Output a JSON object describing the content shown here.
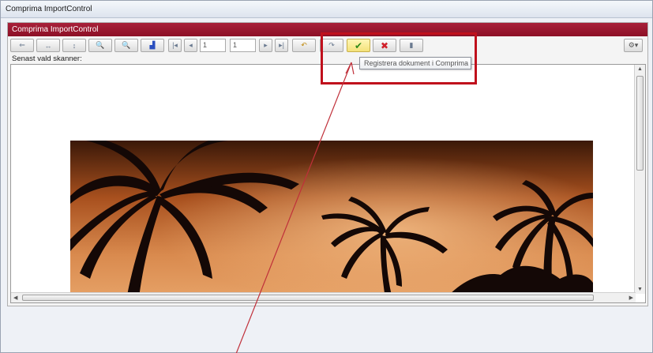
{
  "window": {
    "title": "Comprima ImportControl"
  },
  "panel": {
    "title": "Comprima ImportControl"
  },
  "toolbar": {
    "current_page": "1",
    "total_pages": "1",
    "tooltip": "Registrera dokument i Comprima"
  },
  "scanner": {
    "label": "Senast vald skanner:"
  },
  "icons": {
    "prev_page": "arrow-left-icon",
    "fit_width": "fit-width-icon",
    "fit_height": "fit-height-icon",
    "zoom_in": "zoom-in-icon",
    "zoom_out": "zoom-out-icon",
    "scan": "scanner-icon",
    "first": "first-page-icon",
    "prev": "previous-page-icon",
    "next": "next-page-icon",
    "last": "last-page-icon",
    "rotate_left": "rotate-left-icon",
    "rotate_right": "rotate-right-icon",
    "approve": "checkmark-icon",
    "cancel": "cross-icon",
    "delete": "trash-icon",
    "settings": "settings-icon"
  },
  "colors": {
    "header": "#8c1026",
    "highlight": "#c0101c",
    "approve": "#2f8a1a",
    "cancel": "#d0202a"
  }
}
